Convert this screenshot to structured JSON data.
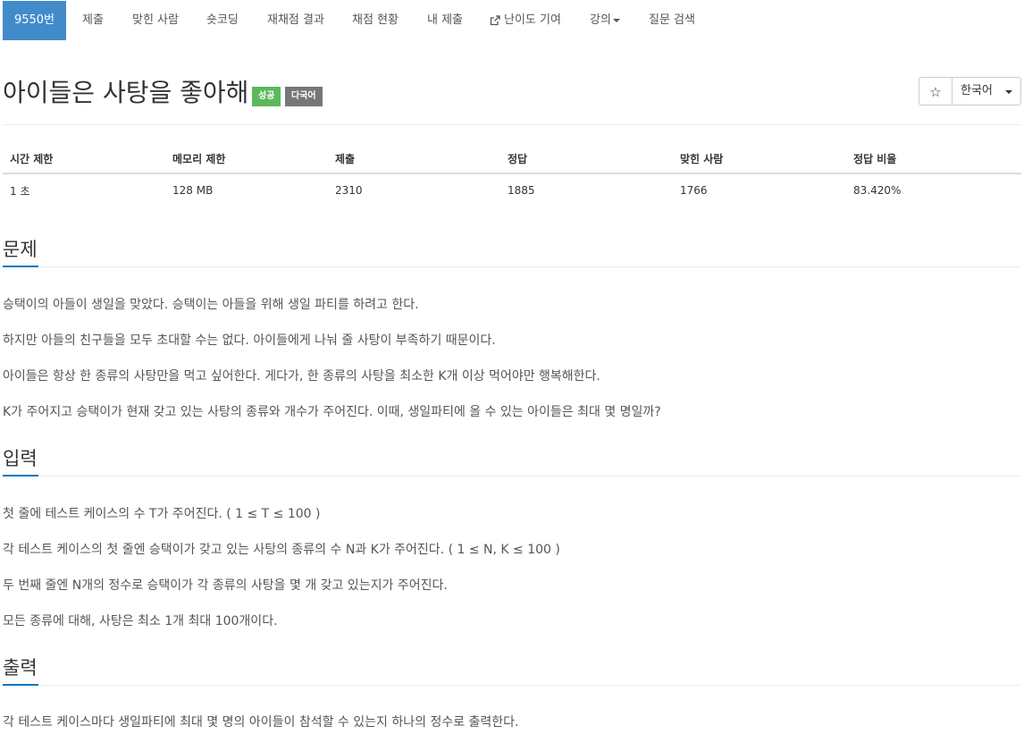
{
  "nav": {
    "items": [
      {
        "label": "9550번",
        "active": true
      },
      {
        "label": "제출"
      },
      {
        "label": "맞힌 사람"
      },
      {
        "label": "숏코딩"
      },
      {
        "label": "재채점 결과"
      },
      {
        "label": "채점 현황"
      },
      {
        "label": "내 제출"
      },
      {
        "label": "난이도 기여",
        "icon": "external-link-icon"
      },
      {
        "label": "강의",
        "icon": "caret-down-icon"
      },
      {
        "label": "질문 검색"
      }
    ]
  },
  "problem": {
    "title": "아이들은 사탕을 좋아해",
    "badge_success": "성공",
    "badge_lang": "다국어",
    "star": "☆",
    "language": "한국어"
  },
  "info_table": {
    "headers": [
      "시간 제한",
      "메모리 제한",
      "제출",
      "정답",
      "맞힌 사람",
      "정답 비율"
    ],
    "row": [
      "1 초",
      "128 MB",
      "2310",
      "1885",
      "1766",
      "83.420%"
    ]
  },
  "sections": {
    "problem": {
      "heading": "문제",
      "paragraphs": [
        "승택이의 아들이 생일을 맞았다. 승택이는 아들을 위해 생일 파티를 하려고 한다.",
        "하지만 아들의 친구들을 모두 초대할 수는 없다. 아이들에게 나눠 줄 사탕이 부족하기 때문이다.",
        "아이들은 항상 한 종류의 사탕만을 먹고 싶어한다. 게다가, 한 종류의 사탕을 최소한 K개 이상 먹어야만 행복해한다.",
        "K가 주어지고 승택이가 현재 갖고 있는 사탕의 종류와 개수가 주어진다. 이때, 생일파티에 올 수 있는 아이들은 최대 몇 명일까?"
      ]
    },
    "input": {
      "heading": "입력",
      "paragraphs": [
        "첫 줄에 테스트 케이스의 수 T가 주어진다. ( 1 ≤ T ≤ 100 )",
        "각 테스트 케이스의 첫 줄엔 승택이가 갖고 있는 사탕의 종류의 수 N과 K가 주어진다. ( 1 ≤ N, K ≤ 100 )",
        "두 번째 줄엔 N개의 정수로 승택이가 각 종류의 사탕을 몇 개 갖고 있는지가 주어진다.",
        "모든 종류에 대해, 사탕은 최소 1개 최대 100개이다."
      ]
    },
    "output": {
      "heading": "출력",
      "paragraphs": [
        "각 테스트 케이스마다 생일파티에 최대 몇 명의 아이들이 참석할 수 있는지 하나의 정수로 출력한다."
      ]
    }
  },
  "colors": {
    "nav_active": "#428bca",
    "success": "#5cb85c",
    "lang_badge": "#777777",
    "section_accent": "#0076c0"
  }
}
